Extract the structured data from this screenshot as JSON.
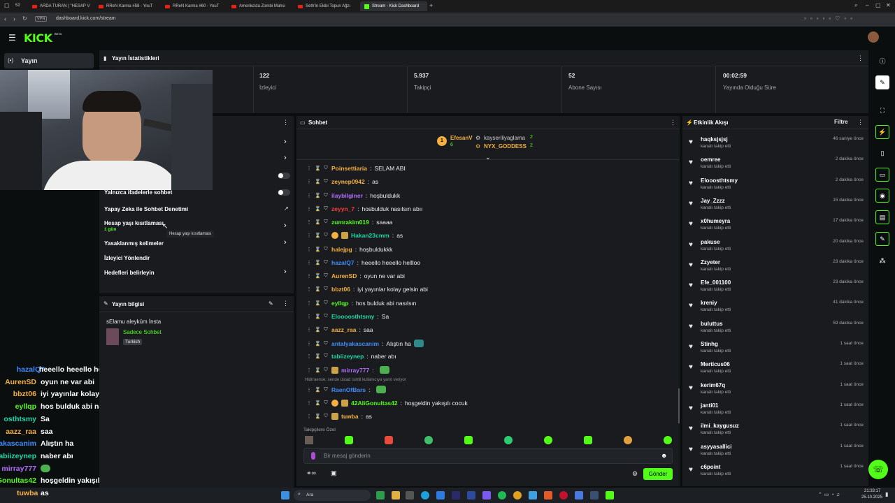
{
  "browser": {
    "tab_count": "52",
    "tabs": [
      "ARDA TURAN | \"HESAP V",
      "RReN Karma #58 - YouT",
      "RReN Karma #60 - YouT",
      "Amerika'da Zombi Mahsi",
      "Seth'in Ekibi Topun Ağzı",
      "Stream - Kick Dashboard"
    ],
    "vpn": "VPN",
    "url": "dashboard.kick.com/stream"
  },
  "kick": {
    "logo": "KICK",
    "logo_beta": "BETA",
    "nav_label": "Yayın"
  },
  "stats": {
    "title": "Yayın İstatistikleri",
    "items": [
      {
        "value": "122",
        "label": "İzleyici"
      },
      {
        "value": "5.937",
        "label": "Takipçi"
      },
      {
        "value": "52",
        "label": "Abone Sayısı"
      },
      {
        "value": "00:02:59",
        "label": "Yayında Olduğu Süre"
      }
    ]
  },
  "settings": {
    "rows": [
      {
        "label": "Yalnızca ifadelerle sohbet"
      },
      {
        "label": "Yapay Zeka ile Sohbet Denetimi"
      },
      {
        "label": "Hesap yaşı kısıtlaması",
        "sub": "1 gün"
      },
      {
        "label": "Yasaklanmış kelimeler"
      },
      {
        "label": "İzleyici Yönlendir"
      },
      {
        "label": "Hedefleri belirleyin"
      }
    ],
    "tooltip": "Hesap yaşı kısıtlaması"
  },
  "stream_info": {
    "title": "Yayın bilgisi",
    "stream_title": "sElamu aleyküm İnsta",
    "category": "Sadece Sohbet",
    "tag": "Turkish"
  },
  "chat": {
    "title": "Sohbet",
    "top_gifters": [
      {
        "rank": "1",
        "name": "EfesanV",
        "count": "6"
      },
      {
        "name": "kayseriliyaglama",
        "count": "2"
      },
      {
        "name": "NYX_GODDESS",
        "count": "2"
      }
    ],
    "messages": [
      {
        "user": "Poinsettiaria",
        "color": "#f5b041",
        "text": "SELAM ABI"
      },
      {
        "user": "zeynep0942",
        "color": "#f5b041",
        "text": "as"
      },
      {
        "user": "ilaybilginer",
        "color": "#b36bff",
        "text": "hoşbuldukk"
      },
      {
        "user": "zeyyn_7",
        "color": "#ff3b3b",
        "text": "hosbulduk nasılsın abıı"
      },
      {
        "user": "zumrakim019",
        "color": "#53fc18",
        "text": "saaaa"
      },
      {
        "user": "Hakan23cmm",
        "color": "#1dd8a8",
        "text": "as"
      },
      {
        "user": "halejpg",
        "color": "#f5b041",
        "text": "hoşbuldukkk"
      },
      {
        "user": "hazalQ7",
        "color": "#3f8cff",
        "text": "heeello heeello hellloo"
      },
      {
        "user": "AurenSD",
        "color": "#f5b041",
        "text": "oyun ne var abi"
      },
      {
        "user": "bbzt06",
        "color": "#f5b041",
        "text": "iyi yayınlar kolay gelsin abi"
      },
      {
        "user": "eyllqp",
        "color": "#53fc18",
        "text": "hos bulduk abi nasılsın"
      },
      {
        "user": "Eloooosthtsmy",
        "color": "#1dd8a8",
        "text": "Sa"
      },
      {
        "user": "aazz_raa",
        "color": "#f5b041",
        "text": "saa"
      },
      {
        "user": "antalyakascanim",
        "color": "#3f8cff",
        "text": "Alıştın ha"
      },
      {
        "user": "tabiizeynep",
        "color": "#1dd8a8",
        "text": "naber abı"
      },
      {
        "user": "mirray777",
        "color": "#b36bff",
        "text": ""
      },
      {
        "user": "RaenOfBars",
        "color": "#3f8cff",
        "text": ""
      },
      {
        "user": "42AliGonultas42",
        "color": "#53fc18",
        "text": "hoşgeldin yakışılı cocuk"
      },
      {
        "user": "tuwba",
        "color": "#f5b041",
        "text": "as"
      }
    ],
    "reply_note": "Hidrraense: sende üstad isimli kullanıcıya yanıt veriyor",
    "followers_only": "Takipçilere Özel",
    "input_placeholder": "Bir mesaj gönderin",
    "send_label": "Gönder"
  },
  "activity": {
    "title": "Etkinlik Akışı",
    "filter_label": "Filtre",
    "sub_label": "kanalı takip etti",
    "items": [
      {
        "user": "haqksjsjsj",
        "time": "46 saniye önce"
      },
      {
        "user": "oemree",
        "time": "2 dakika önce"
      },
      {
        "user": "Elooosthtsmy",
        "time": "2 dakika önce"
      },
      {
        "user": "Jay_Zzzz",
        "time": "15 dakika önce"
      },
      {
        "user": "x0humeyra",
        "time": "17 dakika önce"
      },
      {
        "user": "pakuse",
        "time": "20 dakika önce"
      },
      {
        "user": "Zzyeter",
        "time": "23 dakika önce"
      },
      {
        "user": "Efe_001100",
        "time": "23 dakika önce"
      },
      {
        "user": "kreniy",
        "time": "41 dakika önce"
      },
      {
        "user": "buluttus",
        "time": "59 dakika önce"
      },
      {
        "user": "Stinhg",
        "time": "1 saat önce"
      },
      {
        "user": "Merticus06",
        "time": "1 saat önce"
      },
      {
        "user": "kerim67q",
        "time": "1 saat önce"
      },
      {
        "user": "janti01",
        "time": "1 saat önce"
      },
      {
        "user": "ilmi_kaygusuz",
        "time": "1 saat önce"
      },
      {
        "user": "asyyasallici",
        "time": "1 saat önce"
      },
      {
        "user": "c6point",
        "time": "1 saat önce"
      }
    ]
  },
  "overlay_chat": [
    {
      "user": "hazalQ7",
      "color": "#3f8cff",
      "text": "heeello heeello hellloo"
    },
    {
      "user": "AurenSD",
      "color": "#f5b041",
      "text": "oyun ne var abi"
    },
    {
      "user": "bbzt06",
      "color": "#f5b041",
      "text": "iyi yayınlar kolay gelsin abi"
    },
    {
      "user": "eyllqp",
      "color": "#53fc18",
      "text": "hos bulduk abi nasılsın"
    },
    {
      "user": "osthtsmy",
      "color": "#1dd8a8",
      "text": "Sa"
    },
    {
      "user": "aazz_raa",
      "color": "#f5b041",
      "text": "saa"
    },
    {
      "user": "akascanim",
      "color": "#3f8cff",
      "text": "Alıştın ha"
    },
    {
      "user": "abiizeynep",
      "color": "#1dd8a8",
      "text": "naber abı"
    },
    {
      "user": "mirray777",
      "color": "#b36bff",
      "text": ""
    },
    {
      "user": "Gonultas42",
      "color": "#53fc18",
      "text": "hoşgeldin yakışılı cocuk"
    },
    {
      "user": "tuwba",
      "color": "#f5b041",
      "text": "as"
    }
  ],
  "taskbar": {
    "search_label": "Ara",
    "time": "21:33:17",
    "date": "25.10.2025"
  },
  "colors": {
    "accent": "#53fc18",
    "panel": "#191b1f",
    "bg": "#0b0e0f"
  }
}
